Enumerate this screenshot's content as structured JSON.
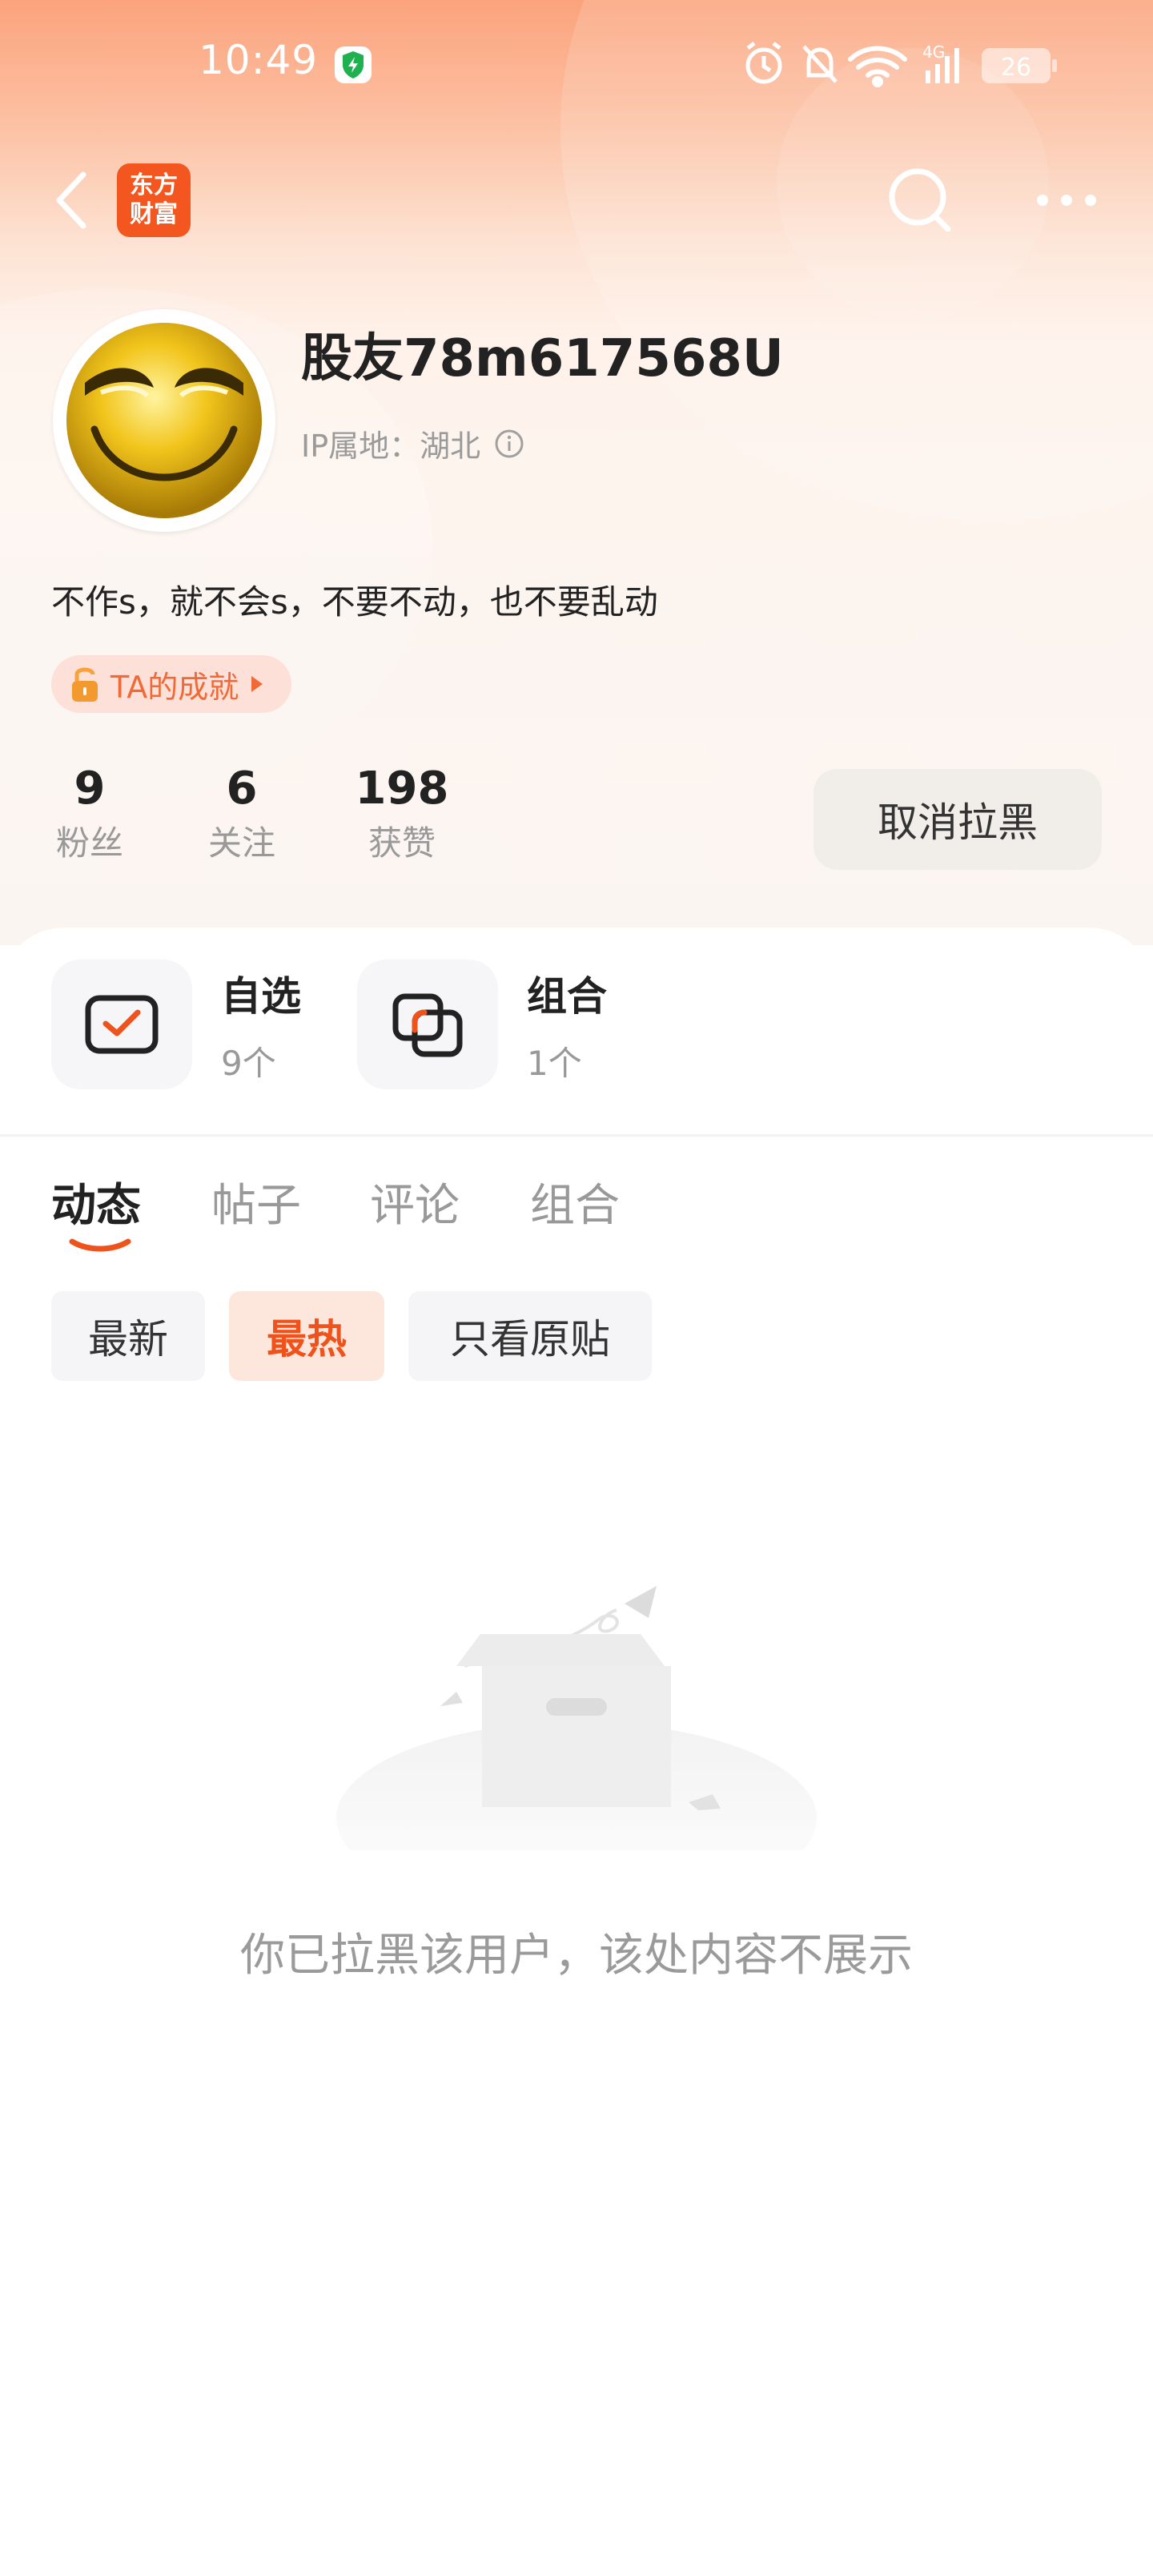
{
  "status_bar": {
    "time": "10:49",
    "network": "4G",
    "battery": "26"
  },
  "top_bar": {
    "logo_line1": "东方",
    "logo_line2": "财富"
  },
  "profile": {
    "username": "股友78m617568U",
    "ip_location": "IP属地：湖北",
    "bio": "不作s，就不会s，不要不动，也不要乱动",
    "achievement_label": "TA的成就"
  },
  "stats": [
    {
      "value": "9",
      "label": "粉丝"
    },
    {
      "value": "6",
      "label": "关注"
    },
    {
      "value": "198",
      "label": "获赞"
    }
  ],
  "unblock_button": "取消拉黑",
  "shortcuts": [
    {
      "title": "自选",
      "count": "9个"
    },
    {
      "title": "组合",
      "count": "1个"
    }
  ],
  "tabs": [
    {
      "label": "动态",
      "active": true
    },
    {
      "label": "帖子",
      "active": false
    },
    {
      "label": "评论",
      "active": false
    },
    {
      "label": "组合",
      "active": false
    }
  ],
  "filters": [
    {
      "label": "最新",
      "active": false
    },
    {
      "label": "最热",
      "active": true
    },
    {
      "label": "只看原贴",
      "active": false
    }
  ],
  "empty_state": {
    "message": "你已拉黑该用户，该处内容不展示"
  },
  "colors": {
    "accent": "#f0521c",
    "header_gradient_top": "#fba37c",
    "brand_logo": "#f3571f"
  }
}
